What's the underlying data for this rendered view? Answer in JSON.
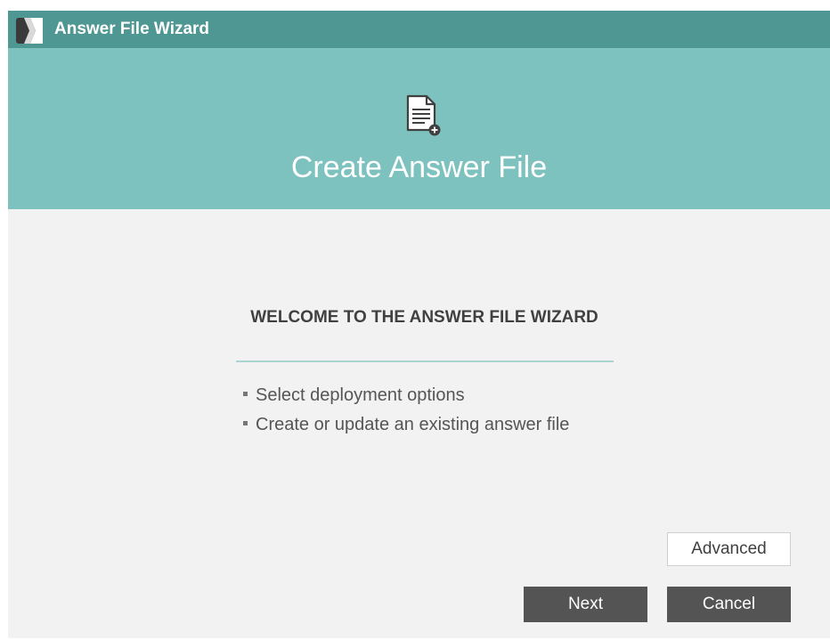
{
  "window": {
    "title": "Answer File Wizard"
  },
  "banner": {
    "title": "Create Answer File",
    "icon": "document-add-icon"
  },
  "content": {
    "heading": "WELCOME TO THE ANSWER FILE WIZARD",
    "bullets": [
      "Select deployment options",
      "Create or update an existing answer file"
    ]
  },
  "buttons": {
    "advanced": "Advanced",
    "next": "Next",
    "cancel": "Cancel"
  },
  "colors": {
    "titlebar": "#4e9793",
    "banner": "#7dc2bf",
    "button_dark": "#545454"
  }
}
